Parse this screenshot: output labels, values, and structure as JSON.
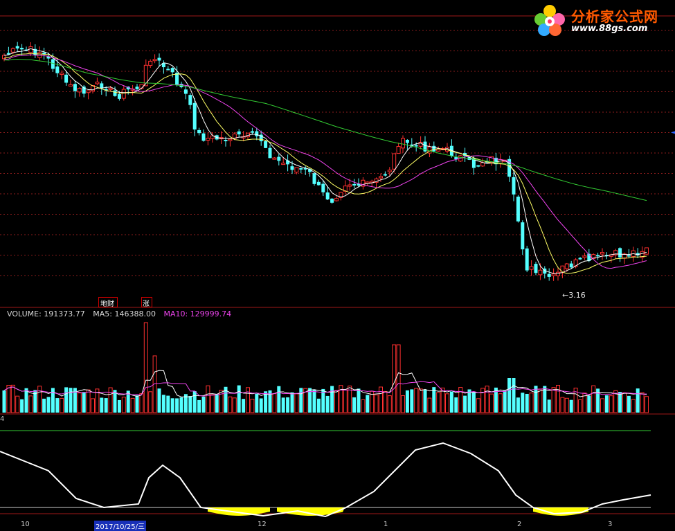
{
  "watermark": {
    "title": "分析家公式网",
    "url": "www.88gs.com"
  },
  "colors": {
    "up": "#ff3030",
    "down": "#54ffff",
    "ma_short": "#ffffff",
    "ma_mid": "#ffff66",
    "ma_long": "#ee44ee",
    "ma_longest": "#33cc33",
    "grid": "#8a1c1c",
    "indicator_line": "#ffffff",
    "indicator_fill": "#ffff00"
  },
  "price_pane": {
    "low_label": "3.16",
    "tags": [
      {
        "label": "地财"
      },
      {
        "label": "涨"
      }
    ]
  },
  "volume_pane": {
    "volume_label": "VOLUME: 191373.77",
    "ma5_label": "MA5: 146388.00",
    "ma10_label": "MA10: 129999.74"
  },
  "indicator_pane": {
    "label": "4"
  },
  "x_axis": {
    "labels": [
      {
        "text": "10"
      },
      {
        "text": "2017/10/25/三",
        "highlight": true
      },
      {
        "text": "12"
      },
      {
        "text": "1"
      },
      {
        "text": "2"
      },
      {
        "text": "3"
      }
    ]
  },
  "chart_data": {
    "type": "candlestick",
    "title": "",
    "series": [
      {
        "name": "VOLUME",
        "latest": 191373.77
      },
      {
        "name": "MA5",
        "latest": 146388.0
      },
      {
        "name": "MA10",
        "latest": 129999.74
      }
    ],
    "price_min_marker": 3.16
  }
}
